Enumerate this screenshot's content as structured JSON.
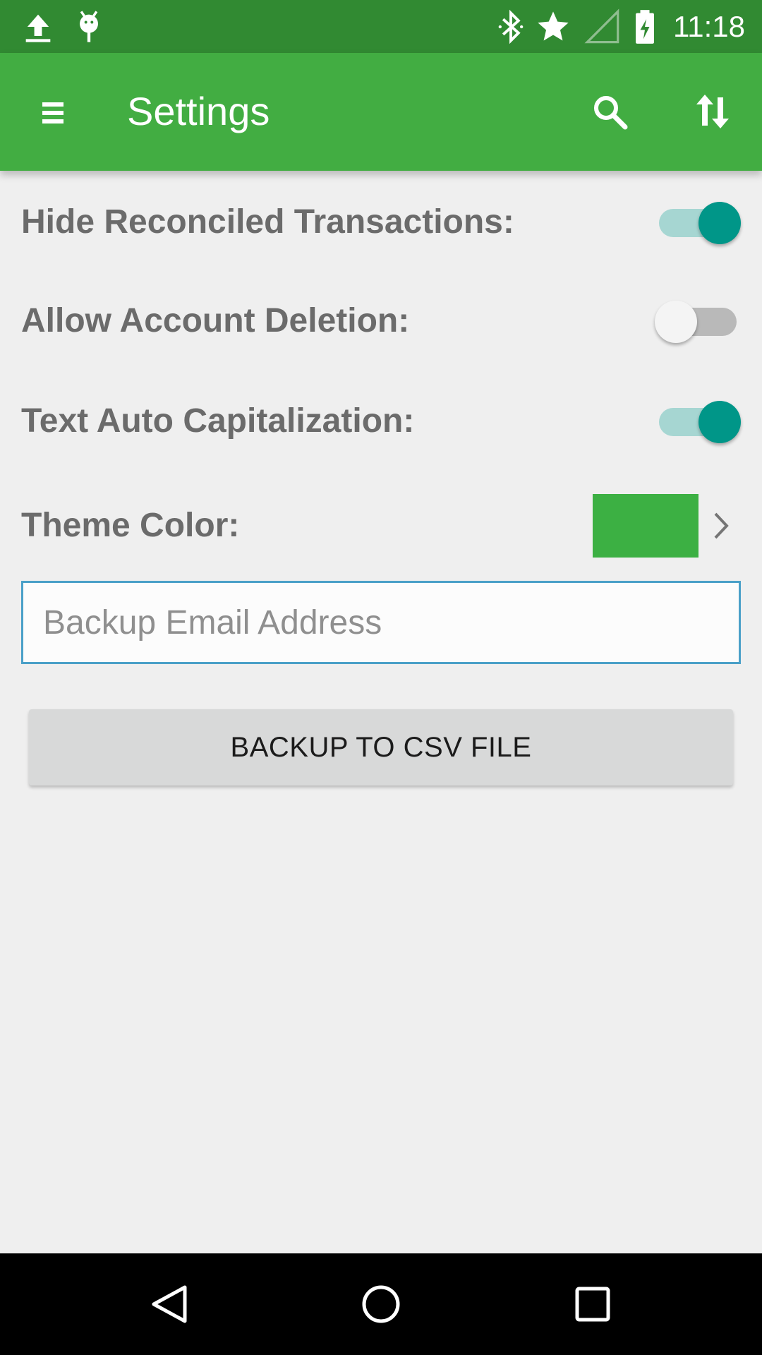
{
  "status_bar": {
    "time": "11:18",
    "icons_left": [
      "upload-icon",
      "android-debug-icon"
    ],
    "icons_right": [
      "bluetooth-icon",
      "star-icon",
      "no-signal-icon",
      "battery-charging-icon"
    ]
  },
  "app_bar": {
    "title": "Settings",
    "menu_icon": "hamburger-menu-icon",
    "actions": [
      "search-icon",
      "sort-icon"
    ]
  },
  "settings": {
    "hide_reconciled": {
      "label": "Hide Reconciled Transactions:",
      "checked": true
    },
    "allow_deletion": {
      "label": "Allow Account Deletion:",
      "checked": false
    },
    "auto_capitalization": {
      "label": "Text Auto Capitalization:",
      "checked": true
    },
    "theme_color": {
      "label": "Theme Color:",
      "value": "#3cb043"
    }
  },
  "backup": {
    "email_placeholder": "Backup Email Address",
    "email_value": "",
    "button_label": "BACKUP TO CSV FILE"
  },
  "nav_bar": {
    "buttons": [
      "back-icon",
      "home-icon",
      "recents-icon"
    ]
  },
  "colors": {
    "status_bar": "#318a32",
    "app_bar": "#42ad42",
    "accent": "#009688",
    "background": "#efefef"
  }
}
